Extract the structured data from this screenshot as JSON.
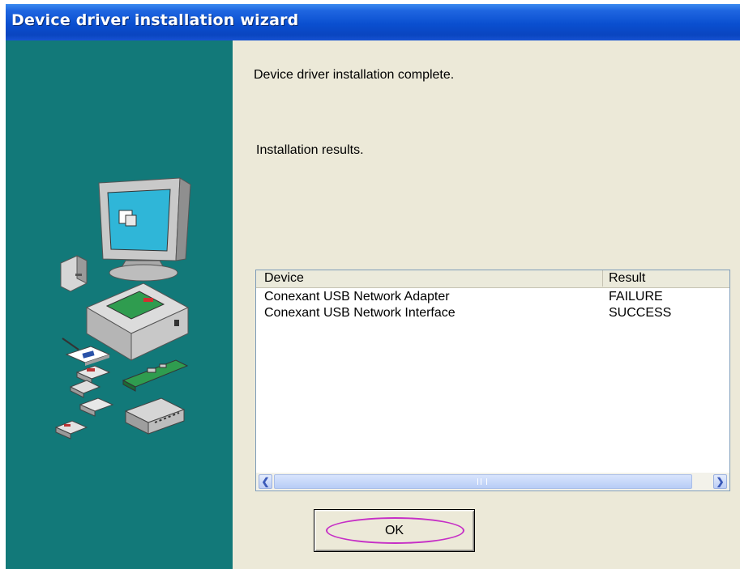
{
  "window": {
    "title": "Device driver installation wizard"
  },
  "sidebar": {
    "illustration": "computer-and-hardware-devices"
  },
  "messages": {
    "complete": "Device driver installation complete.",
    "results_label": "Installation results."
  },
  "results_list": {
    "columns": {
      "device": "Device",
      "result": "Result"
    },
    "rows": [
      {
        "device": "Conexant USB Network Adapter",
        "result": "FAILURE"
      },
      {
        "device": "Conexant USB Network Interface",
        "result": "SUCCESS"
      }
    ],
    "scrollbar": {
      "left_icon": "chevron-left-icon",
      "right_icon": "chevron-right-icon",
      "grip_icon": "scroll-grip-icon"
    }
  },
  "buttons": {
    "ok_label": "OK"
  },
  "colors": {
    "titlebar": "#0a4fd0",
    "sidebar": "#127979",
    "dialog_bg": "#ece9d8",
    "highlight_ring": "#c62fc6"
  }
}
